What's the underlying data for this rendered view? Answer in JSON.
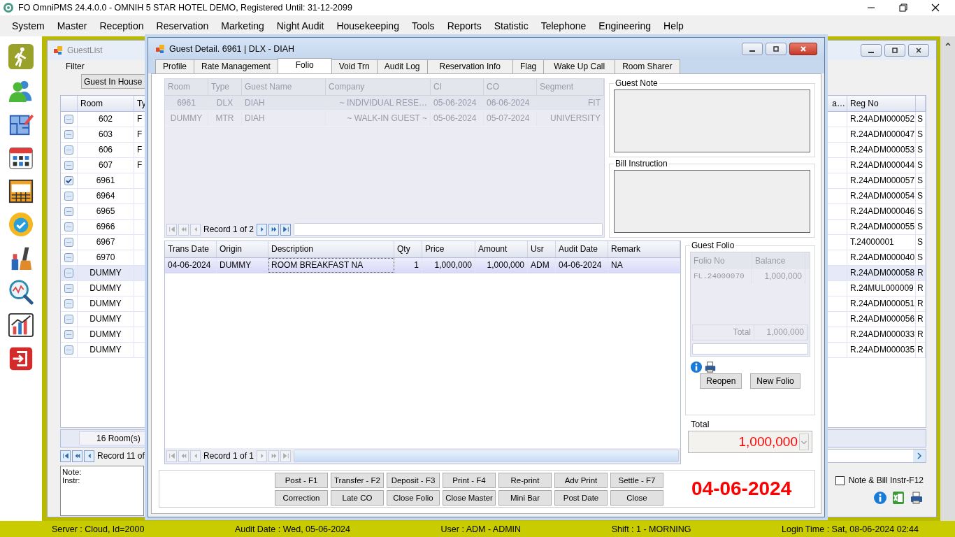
{
  "app": {
    "title": "FO OmniPMS 24.4.0.0 - OMNIH 5 STAR HOTEL DEMO, Registered Until: 31-12-2099"
  },
  "menu": [
    "System",
    "Master",
    "Reception",
    "Reservation",
    "Marketing",
    "Night Audit",
    "Housekeeping",
    "Tools",
    "Reports",
    "Statistic",
    "Telephone",
    "Engineering",
    "Help"
  ],
  "guest_list": {
    "title": "GuestList",
    "filter_label": "Filter",
    "filter_value": "Guest In House",
    "columns": [
      "Room",
      "Ty",
      "a…",
      "Reg No"
    ],
    "rows": [
      {
        "room": "602",
        "type": "F",
        "reg_no": "R.24ADM000052",
        "column_6": "S",
        "checked": false,
        "selected": false
      },
      {
        "room": "603",
        "type": "F",
        "reg_no": "R.24ADM000047",
        "column_6": "S",
        "checked": false,
        "selected": false
      },
      {
        "room": "606",
        "type": "F",
        "reg_no": "R.24ADM000053",
        "column_6": "S",
        "checked": false,
        "selected": false
      },
      {
        "room": "607",
        "type": "F",
        "reg_no": "R.24ADM000044",
        "column_6": "S",
        "checked": false,
        "selected": false
      },
      {
        "room": "6961",
        "reg_no": "R.24ADM000057",
        "column_6": "S",
        "checked": true,
        "selected": false
      },
      {
        "room": "6964",
        "reg_no": "R.24ADM000054",
        "column_6": "S",
        "checked": false,
        "selected": false
      },
      {
        "room": "6965",
        "reg_no": "R.24ADM000046",
        "column_6": "S",
        "checked": false,
        "selected": false
      },
      {
        "room": "6966",
        "reg_no": "R.24ADM000055",
        "column_6": "S",
        "checked": false,
        "selected": false
      },
      {
        "room": "6967",
        "reg_no": "T.24000001",
        "column_6": "S",
        "checked": false,
        "selected": false
      },
      {
        "room": "6970",
        "reg_no": "R.24ADM000040",
        "column_6": "S",
        "checked": false,
        "selected": false
      },
      {
        "room": "DUMMY",
        "reg_no": "R.24ADM000058",
        "column_6": "R",
        "checked": false,
        "selected": true
      },
      {
        "room": "DUMMY",
        "reg_no": "R.24MUL000009",
        "column_6": "R",
        "checked": false,
        "selected": false
      },
      {
        "room": "DUMMY",
        "reg_no": "R.24ADM000051",
        "column_6": "R",
        "checked": false,
        "selected": false
      },
      {
        "room": "DUMMY",
        "reg_no": "R.24ADM000056",
        "column_6": "R",
        "checked": false,
        "selected": false
      },
      {
        "room": "DUMMY",
        "reg_no": "R.24ADM000033",
        "column_6": "R",
        "checked": false,
        "selected": false
      },
      {
        "room": "DUMMY",
        "reg_no": "R.24ADM000035",
        "column_6": "R",
        "checked": false,
        "selected": false
      }
    ],
    "footer": "16 Room(s)",
    "record": "Record 11 of",
    "note_label": "Note:",
    "instr_label": "Instr:",
    "note_checkbox": {
      "label": "Note & Bill Instr-F12",
      "checked": false
    }
  },
  "guest_detail": {
    "title": "Guest Detail. 6961 | DLX - DIAH",
    "tabs": [
      {
        "label": "Profile",
        "selected": false
      },
      {
        "label": "Rate Management",
        "selected": false
      },
      {
        "label": "Folio",
        "selected": true
      },
      {
        "label": "Void Trn",
        "selected": false
      },
      {
        "label": "Audit Log",
        "selected": false
      },
      {
        "label": "Reservation Info",
        "selected": false
      },
      {
        "label": "Flag",
        "selected": false
      },
      {
        "label": "Wake Up Call",
        "selected": false
      },
      {
        "label": "Room Sharer",
        "selected": false
      }
    ],
    "reservations": {
      "columns": [
        "Room",
        "Type",
        "Guest Name",
        "Company",
        "CI",
        "CO",
        "Segment"
      ],
      "rows": [
        [
          "6961",
          "DLX",
          "DIAH",
          "~ INDIVIDUAL RESE…",
          "05-06-2024",
          "06-06-2024",
          "FIT"
        ],
        [
          "DUMMY",
          "MTR",
          "DIAH",
          "~ WALK-IN GUEST ~",
          "05-06-2024",
          "05-07-2024",
          "UNIVERSITY"
        ]
      ],
      "record": "Record 1 of 2"
    },
    "guest_note": {
      "label": "Guest Note"
    },
    "bill_instruction": {
      "label": "Bill Instruction"
    },
    "transactions": {
      "columns": [
        "Trans Date",
        "Origin",
        "Description",
        "Qty",
        "Price",
        "Amount",
        "Usr",
        "Audit Date",
        "Remark"
      ],
      "rows": [
        {
          "cells": [
            "04-06-2024",
            "DUMMY",
            "ROOM BREAKFAST NA",
            "1",
            "1,000,000",
            "1,000,000",
            "ADM",
            "04-06-2024",
            "NA"
          ],
          "selected": true
        }
      ],
      "record": "Record 1 of 1"
    },
    "guest_folio": {
      "label": "Guest Folio",
      "columns": [
        "Folio No",
        "Balance"
      ],
      "rows": [
        [
          "FL.24000070",
          "1,000,000"
        ]
      ],
      "total_label": "Total",
      "total": "1,000,000",
      "buttons": [
        "Reopen",
        "New Folio"
      ]
    },
    "total": {
      "label": "Total",
      "value": "1,000,000"
    },
    "buttons": [
      [
        "Post - F1",
        "Transfer - F2",
        "Deposit - F3",
        "Print - F4",
        "Re-print",
        "Adv Print",
        "Settle - F7"
      ],
      [
        "Correction",
        "Late CO",
        "Close Folio",
        "Close Master",
        "Mini Bar",
        "Post Date",
        "Close"
      ]
    ],
    "date": "04-06-2024"
  },
  "status_bar": [
    "Server : Cloud, Id=2000",
    "Audit Date : Wed, 05-06-2024",
    "User : ADM - ADMIN",
    "Shift : 1 - MORNING",
    "Login Time : Sat, 08-06-2024 02:44"
  ]
}
